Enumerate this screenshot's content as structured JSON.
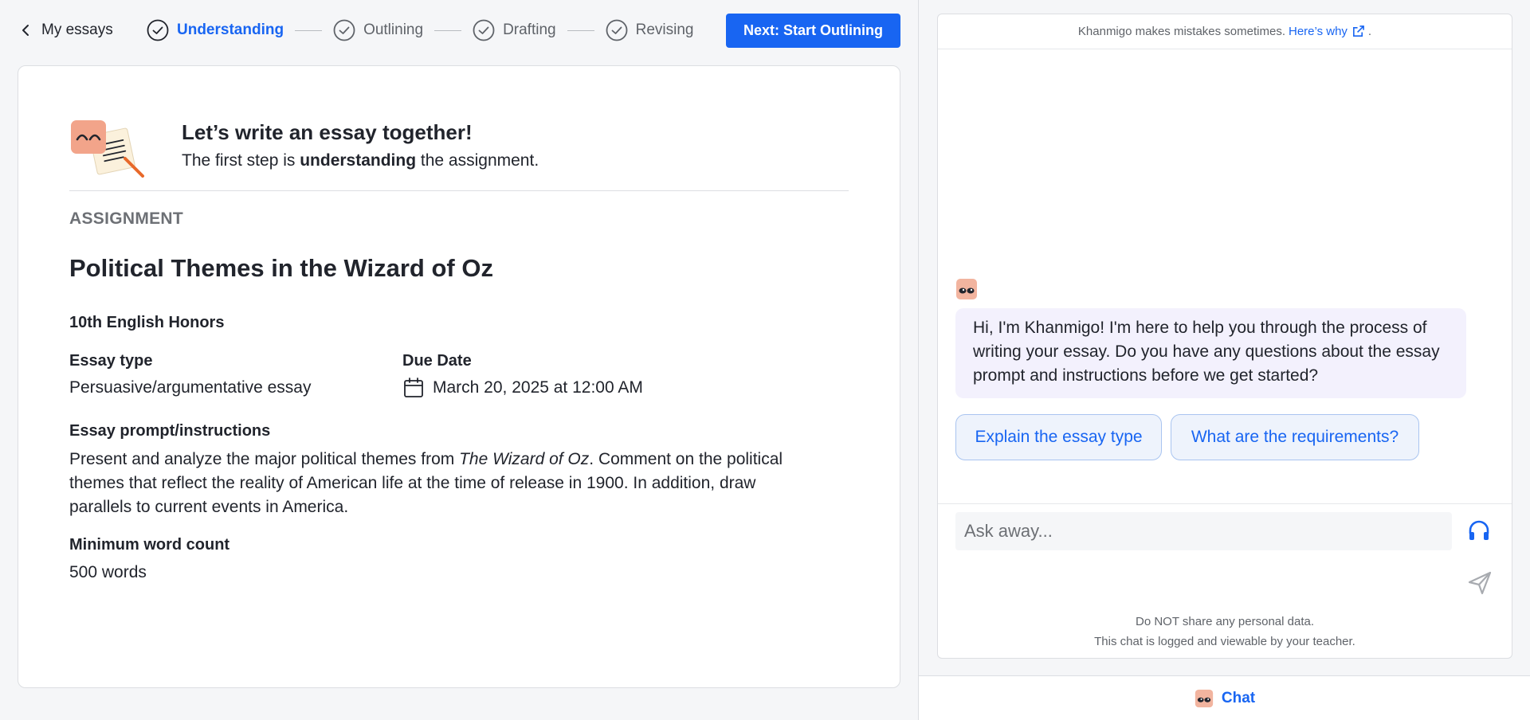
{
  "nav": {
    "back_label": "My essays",
    "steps": [
      {
        "label": "Understanding",
        "state": "active"
      },
      {
        "label": "Outlining",
        "state": "upcoming"
      },
      {
        "label": "Drafting",
        "state": "upcoming"
      },
      {
        "label": "Revising",
        "state": "upcoming"
      }
    ],
    "next_button": "Next: Start Outlining"
  },
  "intro": {
    "title": "Let’s write an essay together!",
    "subtitle_pre": "The first step is ",
    "subtitle_bold": "understanding",
    "subtitle_post": " the assignment."
  },
  "assignment": {
    "section_label": "ASSIGNMENT",
    "title": "Political Themes in the Wizard of Oz",
    "course": "10th English Honors",
    "essay_type_label": "Essay type",
    "essay_type_value": "Persuasive/argumentative essay",
    "due_label": "Due Date",
    "due_value": "March 20, 2025 at 12:00 AM",
    "prompt_label": "Essay prompt/instructions",
    "prompt_pre": "Present and analyze the major political themes from ",
    "prompt_italic": "The Wizard of Oz",
    "prompt_post": ". Comment on the political themes that reflect the reality of American life at the time of release in 1900. In addition, draw parallels to current events in America.",
    "word_count_label": "Minimum word count",
    "word_count_value": "500 words"
  },
  "chat": {
    "disclaimer_text": "Khanmigo makes mistakes sometimes.",
    "disclaimer_link": "Here’s why",
    "disclaimer_end": ".",
    "bot_message": "Hi, I'm Khanmigo! I'm here to help you through the process of writing your essay. Do you have any questions about the essay prompt and instructions before we get started?",
    "suggestions": [
      "Explain the essay type",
      "What are the requirements?"
    ],
    "input_placeholder": "Ask away...",
    "footer_line1": "Do NOT share any personal data.",
    "footer_line2": "This chat is logged and viewable by your teacher.",
    "tab_label": "Chat"
  },
  "colors": {
    "accent": "#1865f2",
    "bubble_bg": "#f3f1fd",
    "chip_bg": "#eef3fc"
  }
}
